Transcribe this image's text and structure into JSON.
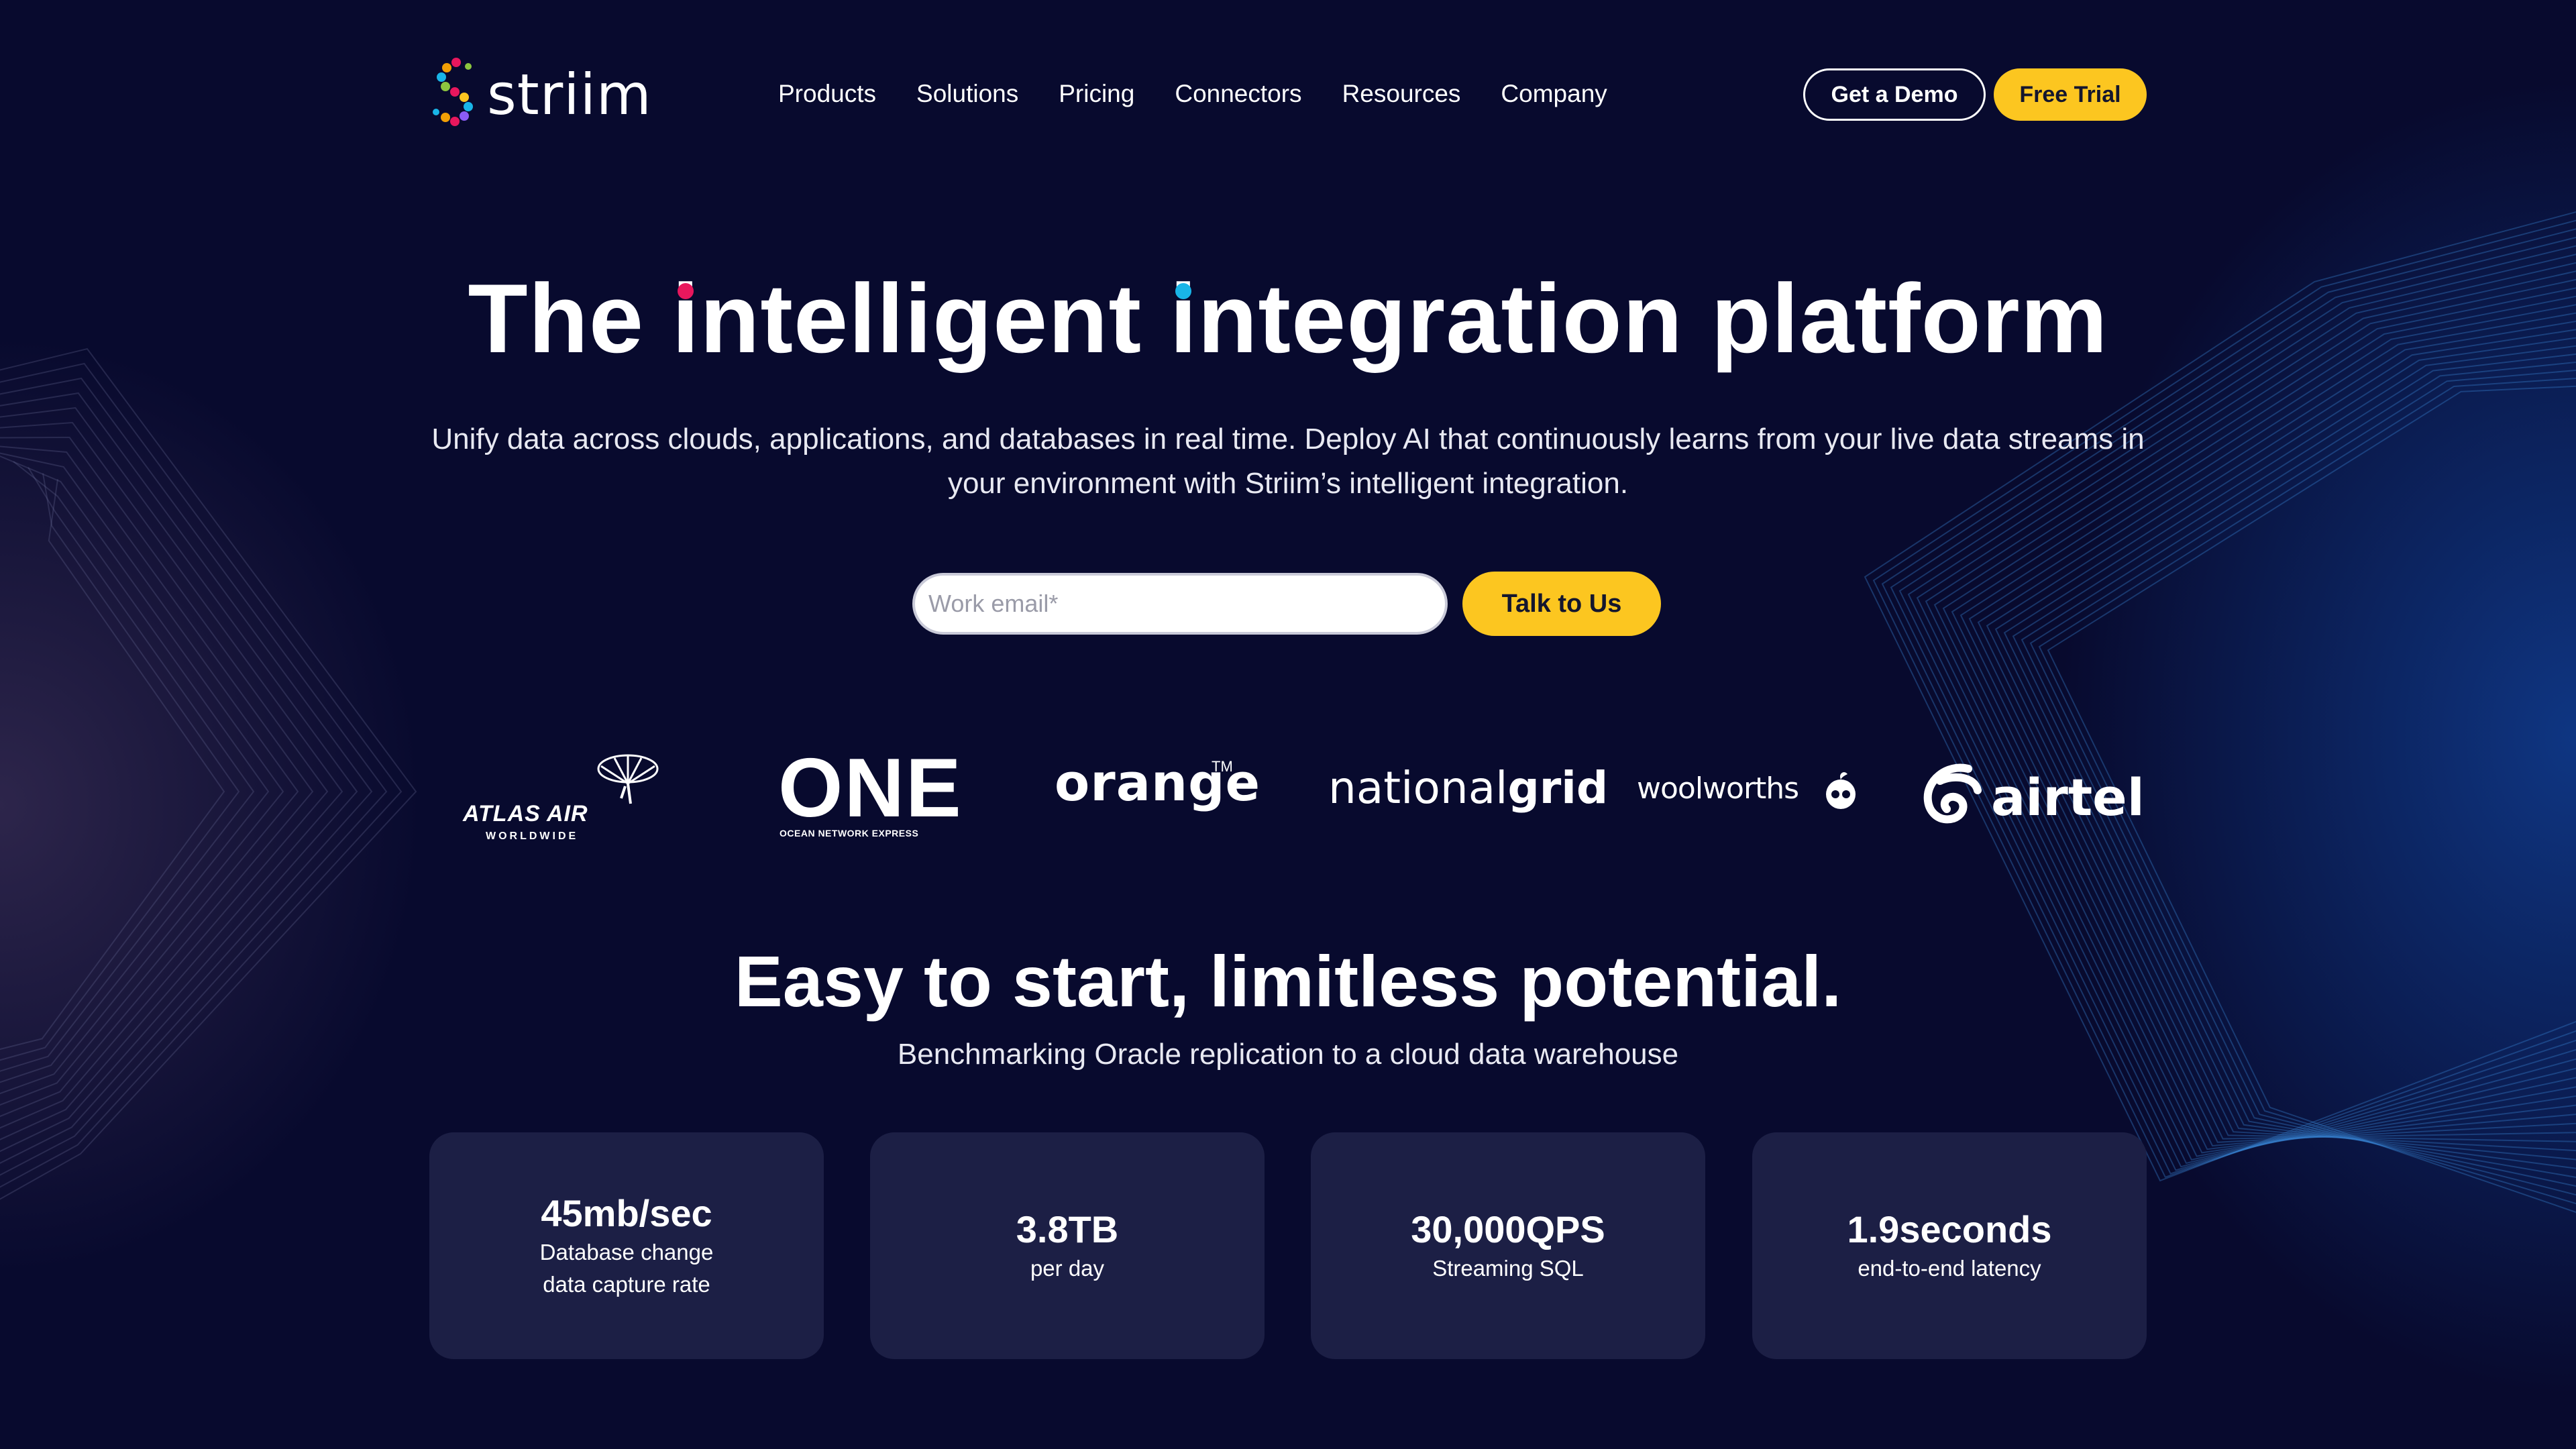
{
  "brand": {
    "name": "striim"
  },
  "nav": {
    "links": [
      "Products",
      "Solutions",
      "Pricing",
      "Connectors",
      "Resources",
      "Company"
    ],
    "demo_label": "Get a Demo",
    "trial_label": "Free Trial"
  },
  "hero": {
    "title_part1": "The ",
    "title_i1": "i",
    "title_part2": "ntelligent ",
    "title_i2": "i",
    "title_part3": "ntegration platform",
    "subtitle": "Unify data across clouds, applications, and databases in real time. Deploy AI that continuously learns from your live data streams in your environment with Striim’s intelligent integration.",
    "email_placeholder": "Work email*",
    "cta_label": "Talk to Us"
  },
  "customers": {
    "atlas": {
      "name": "ATLAS AIR",
      "sub": "WORLDWIDE"
    },
    "one": {
      "name": "ONE",
      "sub": "OCEAN NETWORK EXPRESS"
    },
    "orange": {
      "name": "orange",
      "tm": "TM"
    },
    "nationalgrid": {
      "part1": "national",
      "part2": "grid"
    },
    "woolworths": {
      "name": "woolworths"
    },
    "airtel": {
      "name": "airtel"
    }
  },
  "section": {
    "title": "Easy to start, limitless potential.",
    "subtitle": "Benchmarking Oracle replication to a cloud data warehouse"
  },
  "stats": [
    {
      "value": "45mb/sec",
      "label": "Database change data capture rate"
    },
    {
      "value": "3.8TB",
      "label": "per day"
    },
    {
      "value": "30,000QPS",
      "label": "Streaming SQL"
    },
    {
      "value": "1.9seconds",
      "label": "end-to-end latency"
    }
  ],
  "colors": {
    "background": "#080a2e",
    "accent_yellow": "#fcc620",
    "card": "#1c1f45",
    "dot_pink": "#e8175d",
    "dot_cyan": "#19b5e8"
  }
}
